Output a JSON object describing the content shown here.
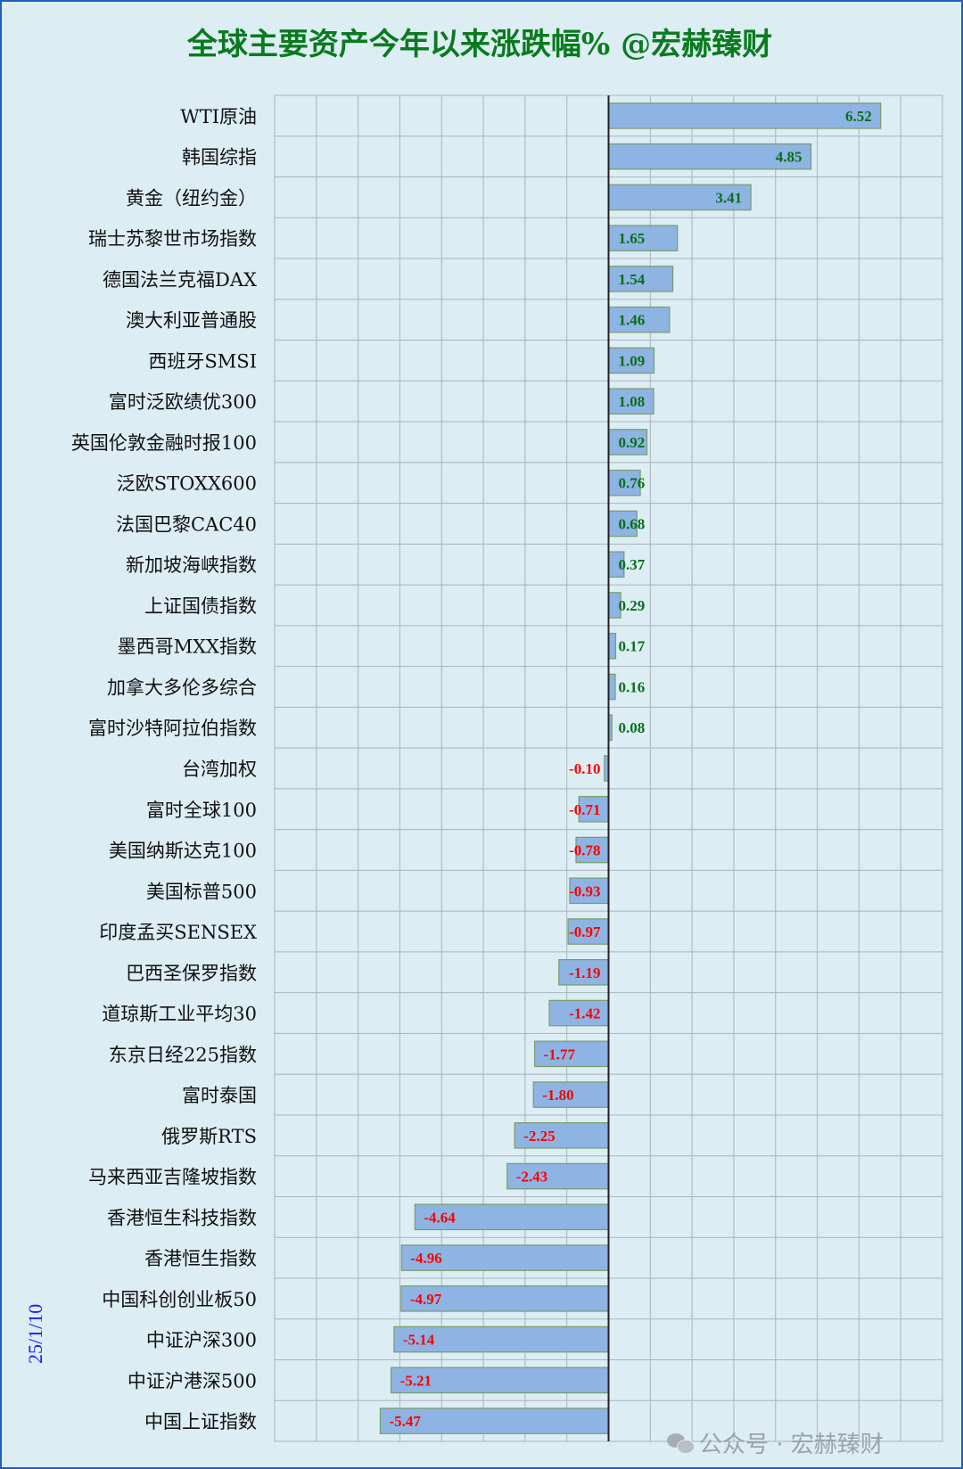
{
  "title": "全球主要资产今年以来涨跌幅% @宏赫臻财",
  "date_stamp": "25/1/10",
  "watermark": "公众号 · 宏赫臻财",
  "colors": {
    "bar_fill": "#8eb4e3",
    "bar_stroke": "#7a9c6a",
    "positive_label": "#0a6e1a",
    "negative_label": "#ff0000",
    "title": "#0a7a1e",
    "grid": "#a9b6bb",
    "axis": "#222222"
  },
  "chart_data": {
    "type": "bar",
    "orientation": "horizontal",
    "grid": true,
    "xlim": [
      -8,
      8
    ],
    "categories": [
      "WTI原油",
      "韩国综指",
      "黄金（纽约金）",
      "瑞士苏黎世市场指数",
      "德国法兰克福DAX",
      "澳大利亚普通股",
      "西班牙SMSI",
      "富时泛欧绩优300",
      "英国伦敦金融时报100",
      "泛欧STOXX600",
      "法国巴黎CAC40",
      "新加坡海峡指数",
      "上证国债指数",
      "墨西哥MXX指数",
      "加拿大多伦多综合",
      "富时沙特阿拉伯指数",
      "台湾加权",
      "富时全球100",
      "美国纳斯达克100",
      "美国标普500",
      "印度孟买SENSEX",
      "巴西圣保罗指数",
      "道琼斯工业平均30",
      "东京日经225指数",
      "富时泰国",
      "俄罗斯RTS",
      "马来西亚吉隆坡指数",
      "香港恒生科技指数",
      "香港恒生指数",
      "中国科创创业板50",
      "中证沪深300",
      "中证沪港深500",
      "中国上证指数"
    ],
    "values": [
      6.52,
      4.85,
      3.41,
      1.65,
      1.54,
      1.46,
      1.09,
      1.08,
      0.92,
      0.76,
      0.68,
      0.37,
      0.29,
      0.17,
      0.16,
      0.08,
      -0.1,
      -0.71,
      -0.78,
      -0.93,
      -0.97,
      -1.19,
      -1.42,
      -1.77,
      -1.8,
      -2.25,
      -2.43,
      -4.64,
      -4.96,
      -4.97,
      -5.14,
      -5.21,
      -5.47
    ],
    "labels": [
      "6.52",
      "4.85",
      "3.41",
      "1.65",
      "1.54",
      "1.46",
      "1.09",
      "1.08",
      "0.92",
      "0.76",
      "0.68",
      "0.37",
      "0.29",
      "0.17",
      "0.16",
      "0.08",
      "-0.10",
      "-0.71",
      "-0.78",
      "-0.93",
      "-0.97",
      "-1.19",
      "-1.42",
      "-1.77",
      "-1.80",
      "-2.25",
      "-2.43",
      "-4.64",
      "-4.96",
      "-4.97",
      "-5.14",
      "-5.21",
      "-5.47"
    ]
  }
}
